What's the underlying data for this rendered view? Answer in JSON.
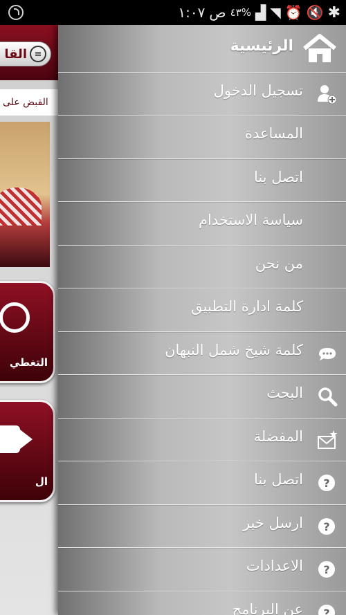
{
  "status_bar": {
    "time": "١:٠٧",
    "period": "ص",
    "battery": "٤٣%"
  },
  "background": {
    "header_title": "القا",
    "ticker_text": "القبض  على",
    "tile1_label": "التغطي",
    "tile2_label": "ال"
  },
  "drawer": {
    "home_label": "الرئيسية",
    "items": [
      {
        "label": "تسجيل الدخول",
        "icon": "add-user-icon"
      },
      {
        "label": "المساعدة",
        "icon": ""
      },
      {
        "label": "اتصل بنا",
        "icon": ""
      },
      {
        "label": "سياسة الاستخدام",
        "icon": ""
      },
      {
        "label": "من نحن",
        "icon": ""
      },
      {
        "label": "كلمة ادارة التطبيق",
        "icon": ""
      },
      {
        "label": "كلمة شيخ شمل النبهان",
        "icon": "chat-icon"
      },
      {
        "label": "البحث",
        "icon": "search-icon"
      },
      {
        "label": "المفضلة",
        "icon": "favorite-mail-icon"
      },
      {
        "label": "اتصل بنا",
        "icon": "help-icon"
      },
      {
        "label": "ارسل خبر",
        "icon": "help-icon"
      },
      {
        "label": "الاعدادات",
        "icon": "help-icon"
      },
      {
        "label": "عن البرنامج",
        "icon": "help-icon"
      }
    ]
  }
}
